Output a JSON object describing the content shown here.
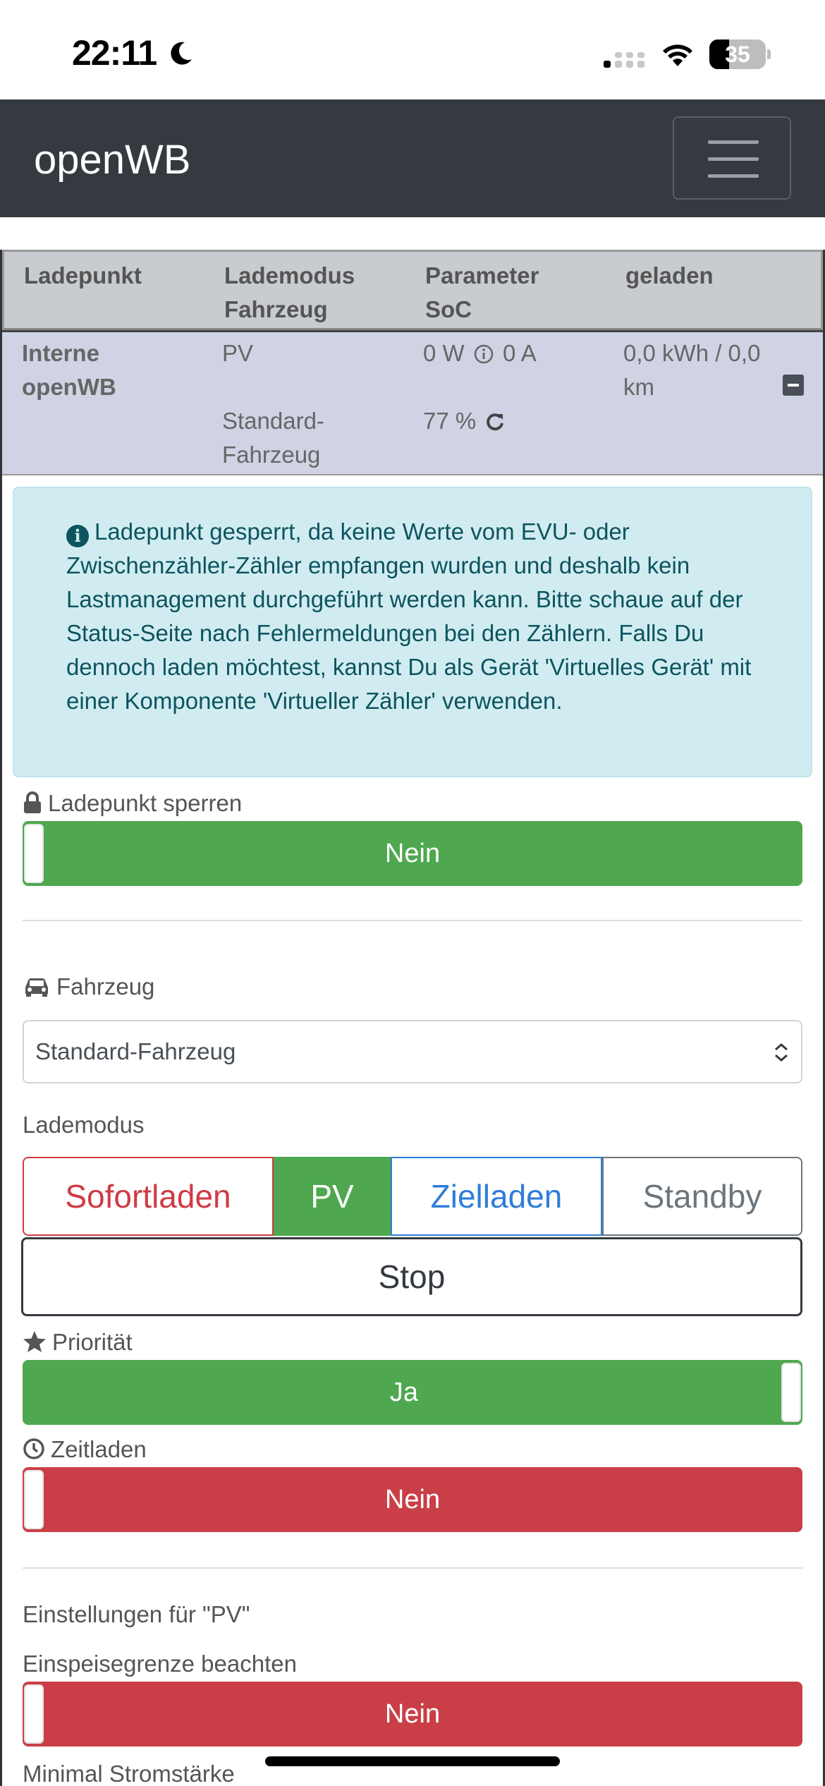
{
  "status_bar": {
    "time": "22:11",
    "battery": "35",
    "battery_fraction": 0.35
  },
  "navbar": {
    "brand": "openWB"
  },
  "table": {
    "headers": [
      {
        "line1": "Ladepunkt",
        "line2": ""
      },
      {
        "line1": "Lademodus",
        "line2": "Fahrzeug"
      },
      {
        "line1": "Parameter",
        "line2": "SoC"
      },
      {
        "line1": "geladen",
        "line2": ""
      }
    ],
    "row": {
      "name_line1": "Interne",
      "name_line2": "openWB",
      "mode": "PV",
      "vehicle_line1": "Standard-",
      "vehicle_line2": "Fahrzeug",
      "power": "0 W",
      "current": "0 A",
      "soc": "77 %",
      "charged_line1": "0,0 kWh / 0,0",
      "charged_line2": "km"
    }
  },
  "alert": {
    "text": "Ladepunkt gesperrt, da keine Werte vom EVU- oder Zwischenzähler-Zähler empfangen wurden und deshalb kein Lastmanagement durchgeführt werden kann. Bitte schaue auf der Status-Seite nach Fehlermeldungen bei den Zählern. Falls Du dennoch laden möchtest, kannst Du als Gerät 'Virtuelles Gerät' mit einer Komponente 'Virtueller Zähler' verwenden."
  },
  "form": {
    "lock_label": "Ladepunkt sperren",
    "lock_value": "Nein",
    "vehicle_label": "Fahrzeug",
    "vehicle_value": "Standard-Fahrzeug",
    "mode_label": "Lademodus",
    "modes": [
      "Sofortladen",
      "PV",
      "Zielladen",
      "Standby"
    ],
    "selected_mode": "PV",
    "stop_label": "Stop",
    "priority_label": "Priorität",
    "priority_value": "Ja",
    "timed_label": "Zeitladen",
    "timed_value": "Nein",
    "pv_settings_title": "Einstellungen für \"PV\"",
    "feed_in_label": "Einspeisegrenze beachten",
    "feed_in_value": "Nein",
    "min_current_label": "Minimal Stromstärke"
  },
  "colors": {
    "navbar": "#343a40",
    "success": "#4fa84f",
    "danger": "#ca3f47",
    "primary": "#2f7ed8",
    "secondary": "#6c757d",
    "alert_info_bg": "#d1ecf1",
    "alert_info_text": "#0c5460",
    "table_header_bg": "#c8cbcf",
    "table_row_bg": "#cfd3e4"
  },
  "icons": {
    "moon": "moon-icon",
    "signal": "cellular-signal-icon",
    "wifi": "wifi-icon",
    "battery": "battery-icon",
    "menu": "hamburger-menu-icon",
    "info": "info-circle-icon",
    "lock": "lock-icon",
    "car": "car-icon",
    "star": "star-icon",
    "clock": "clock-icon",
    "refresh": "refresh-icon",
    "collapse": "minus-square-icon",
    "select_caret": "select-caret-icon"
  }
}
